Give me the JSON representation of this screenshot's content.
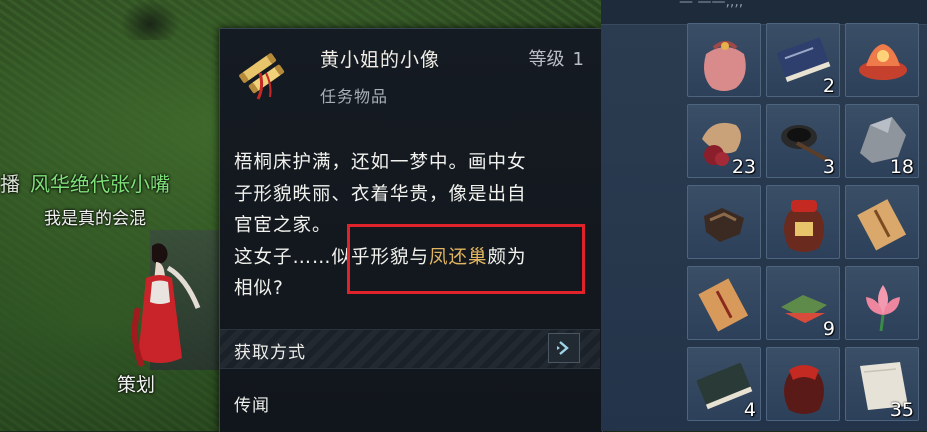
{
  "npc": {
    "lead_char": "播",
    "name": "风华绝代张小嘴",
    "subtitle": "我是真的会混",
    "role": "策划"
  },
  "tooltip": {
    "item_name": "黄小姐的小像",
    "level_label": "等级",
    "level_value": "1",
    "item_type": "任务物品",
    "description": {
      "line1": "梧桐床护满，还如一梦中。画中女",
      "line2": "子形貌昳丽、衣着华贵，像是出自",
      "line3": "官宦之家。",
      "line4_before": "这女子……似乎形貌与",
      "line4_highlight": "凤还巢",
      "line4_after": "颇为",
      "line5": "相似?"
    },
    "section_obtain": "获取方式",
    "section_rumor": "传闻"
  },
  "inventory": {
    "header_text": "— ——,,,,",
    "slots": [
      {
        "icon": "pouch-icon",
        "count": ""
      },
      {
        "icon": "book-icon",
        "count": "2"
      },
      {
        "icon": "lotus-lamp-icon",
        "count": ""
      },
      {
        "icon": "bean-sack-icon",
        "count": "23"
      },
      {
        "icon": "ink-stone-icon",
        "count": "3"
      },
      {
        "icon": "ore-icon",
        "count": "18"
      },
      {
        "icon": "mechanism-icon",
        "count": ""
      },
      {
        "icon": "wine-jar-icon",
        "count": ""
      },
      {
        "icon": "letter-icon",
        "count": ""
      },
      {
        "icon": "scroll-note-icon",
        "count": ""
      },
      {
        "icon": "rice-cake-icon",
        "count": "9"
      },
      {
        "icon": "lotus-flower-icon",
        "count": ""
      },
      {
        "icon": "dark-book-icon",
        "count": "4"
      },
      {
        "icon": "red-jar-icon",
        "count": ""
      },
      {
        "icon": "paper-icon",
        "count": "35"
      }
    ]
  },
  "colors": {
    "npc_name": "#7fe07a",
    "highlight_text": "#e2b560",
    "highlight_box": "#e0232a"
  }
}
